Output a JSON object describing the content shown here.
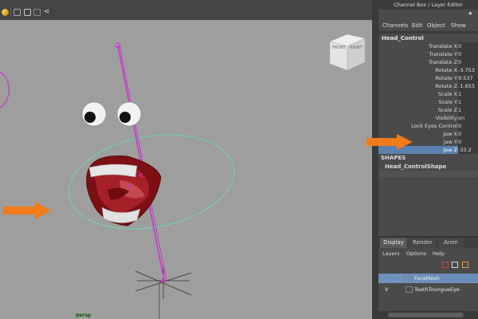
{
  "window": {
    "title": "Channel Box / Layer Editor"
  },
  "channel_box": {
    "menu": [
      "Channels",
      "Edit",
      "Object",
      "Show"
    ],
    "object_name": "Head_Control",
    "attributes": [
      {
        "label": "Translate X",
        "value": "0"
      },
      {
        "label": "Translate Y",
        "value": "0"
      },
      {
        "label": "Translate Z",
        "value": "0"
      },
      {
        "label": "Rotate X",
        "value": "-3.753"
      },
      {
        "label": "Rotate Y",
        "value": "9.537"
      },
      {
        "label": "Rotate Z",
        "value": "-1.655"
      },
      {
        "label": "Scale X",
        "value": "1"
      },
      {
        "label": "Scale Y",
        "value": "1"
      },
      {
        "label": "Scale Z",
        "value": "1"
      },
      {
        "label": "Visibility",
        "value": "on"
      },
      {
        "label": "Lock Eyes Control",
        "value": "0"
      },
      {
        "label": "Jaw X",
        "value": "0"
      },
      {
        "label": "Jaw Y",
        "value": "0"
      },
      {
        "label": "Jaw Z",
        "value": "-33.2"
      }
    ],
    "selected_attribute": "Jaw Z",
    "shapes_header": "SHAPES",
    "shapes": [
      "Head_ControlShape"
    ]
  },
  "layer_editor": {
    "tabs": [
      "Display",
      "Render",
      "Anim"
    ],
    "active_tab": "Display",
    "menu": [
      "Layers",
      "Options",
      "Help"
    ],
    "layers": [
      {
        "name": "FaceMesh",
        "visible": "",
        "selected": true
      },
      {
        "name": "TeathToungueEye",
        "visible": "V",
        "selected": false
      }
    ]
  },
  "viewport": {
    "camera_label": "persp",
    "viewcube": {
      "front": "FRONT",
      "right": "RIGHT"
    }
  },
  "colors": {
    "accent_arrow": "#f07b1a",
    "selection": "#5a82b0",
    "control_curve": "#cc33cc",
    "ring_curve": "#6fd6a6"
  },
  "icons": [
    "sphere-icon",
    "cube-icon",
    "wireframe-icon",
    "share-icon",
    "maya-logo-icon",
    "new-layer-icon",
    "new-layer-from-selected-icon",
    "move-layer-icon"
  ]
}
